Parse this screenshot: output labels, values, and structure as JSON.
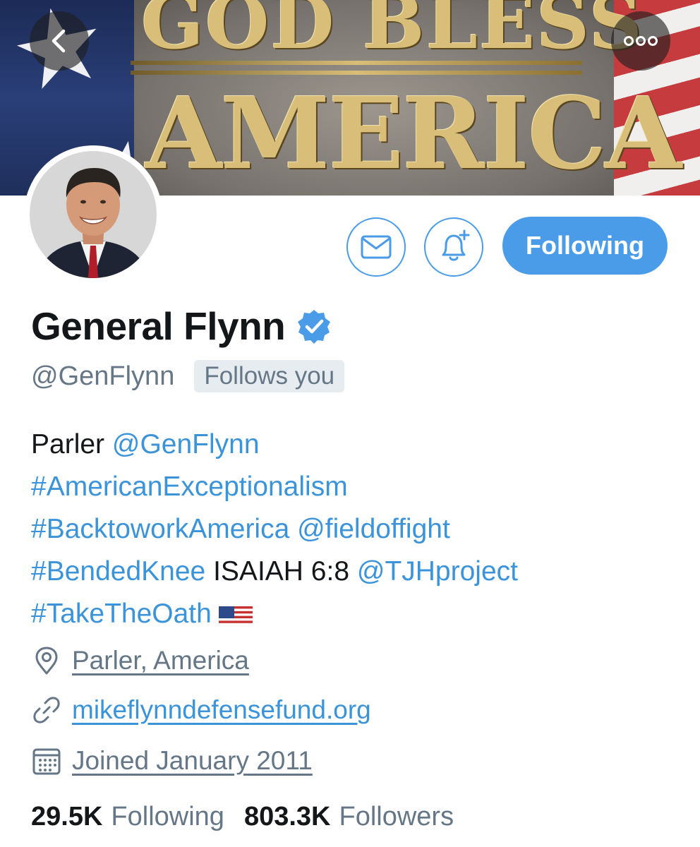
{
  "banner": {
    "text_top": "GOD BLESS",
    "text_main": "AMERICA"
  },
  "nav": {
    "back_icon": "chevron-left-icon",
    "more_icon": "more-horizontal-icon"
  },
  "actions": {
    "message_icon": "envelope-icon",
    "notify_icon": "bell-plus-icon",
    "follow_label": "Following"
  },
  "profile": {
    "display_name": "General Flynn",
    "verified": true,
    "handle": "@GenFlynn",
    "follows_you": "Follows you"
  },
  "bio": {
    "line1_text": "Parler ",
    "line1_link": "@GenFlynn",
    "line2_link": "#AmericanExceptionalism",
    "line3_link_a": "#BacktoworkAmerica",
    "line3_link_b": "@fieldoffight",
    "line4_link_a": "#BendedKnee",
    "line4_text": " ISAIAH 6:8 ",
    "line4_link_b": "@TJHproject",
    "line5_link": "#TakeTheOath",
    "line5_emoji": "us-flag-emoji"
  },
  "meta": {
    "location": "Parler, America",
    "website": "mikeflynndefensefund.org",
    "joined": "Joined January 2011"
  },
  "counts": {
    "following_num": "29.5K",
    "following_label": "Following",
    "followers_num": "803.3K",
    "followers_label": "Followers"
  },
  "colors": {
    "accent": "#4a9be8",
    "link": "#3b94d9",
    "muted": "#657786",
    "text": "#14171a"
  }
}
